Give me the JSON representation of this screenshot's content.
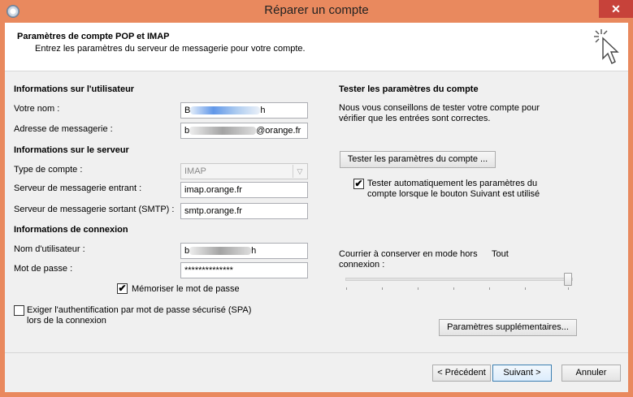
{
  "window": {
    "title": "Réparer un compte",
    "close_glyph": "✕"
  },
  "header": {
    "title": "Paramètres de compte POP et IMAP",
    "subtitle": "Entrez les paramètres du serveur de messagerie pour votre compte."
  },
  "user_info": {
    "section": "Informations sur l'utilisateur",
    "name_label": "Votre nom :",
    "name_prefix": "B",
    "name_suffix": "h",
    "email_label": "Adresse de messagerie :",
    "email_prefix": "b",
    "email_suffix": "@orange.fr"
  },
  "server_info": {
    "section": "Informations sur le serveur",
    "account_type_label": "Type de compte :",
    "account_type_value": "IMAP",
    "incoming_label": "Serveur de messagerie entrant :",
    "incoming_value": "imap.orange.fr",
    "outgoing_label": "Serveur de messagerie sortant (SMTP) :",
    "outgoing_value": "smtp.orange.fr"
  },
  "login_info": {
    "section": "Informations de connexion",
    "username_label": "Nom d'utilisateur :",
    "username_prefix": "b",
    "username_suffix": "h",
    "password_label": "Mot de passe :",
    "password_value": "**************",
    "remember_label": "Mémoriser le mot de passe",
    "remember_checked": true,
    "spa_label_line1": "Exiger l'authentification par mot de passe sécurisé (SPA)",
    "spa_label_line2": "lors de la connexion",
    "spa_checked": false
  },
  "test_settings": {
    "section": "Tester les paramètres du compte",
    "desc_line1": "Nous vous conseillons de tester votre compte pour",
    "desc_line2": "vérifier que les entrées sont correctes.",
    "test_button": "Tester les paramètres du compte ...",
    "auto_test_line1": "Tester automatiquement les paramètres du",
    "auto_test_line2": "compte lorsque le bouton Suivant est utilisé",
    "auto_test_checked": true
  },
  "offline": {
    "label_line1": "Courrier à conserver en mode hors",
    "label_line2": "connexion :",
    "value": "Tout",
    "slider_fraction": 1.0
  },
  "buttons": {
    "more_settings": "Paramètres supplémentaires...",
    "previous": "< Précédent",
    "next": "Suivant >",
    "cancel": "Annuler"
  },
  "checkmark_glyph": "✔",
  "dropdown_glyph": "▽"
}
